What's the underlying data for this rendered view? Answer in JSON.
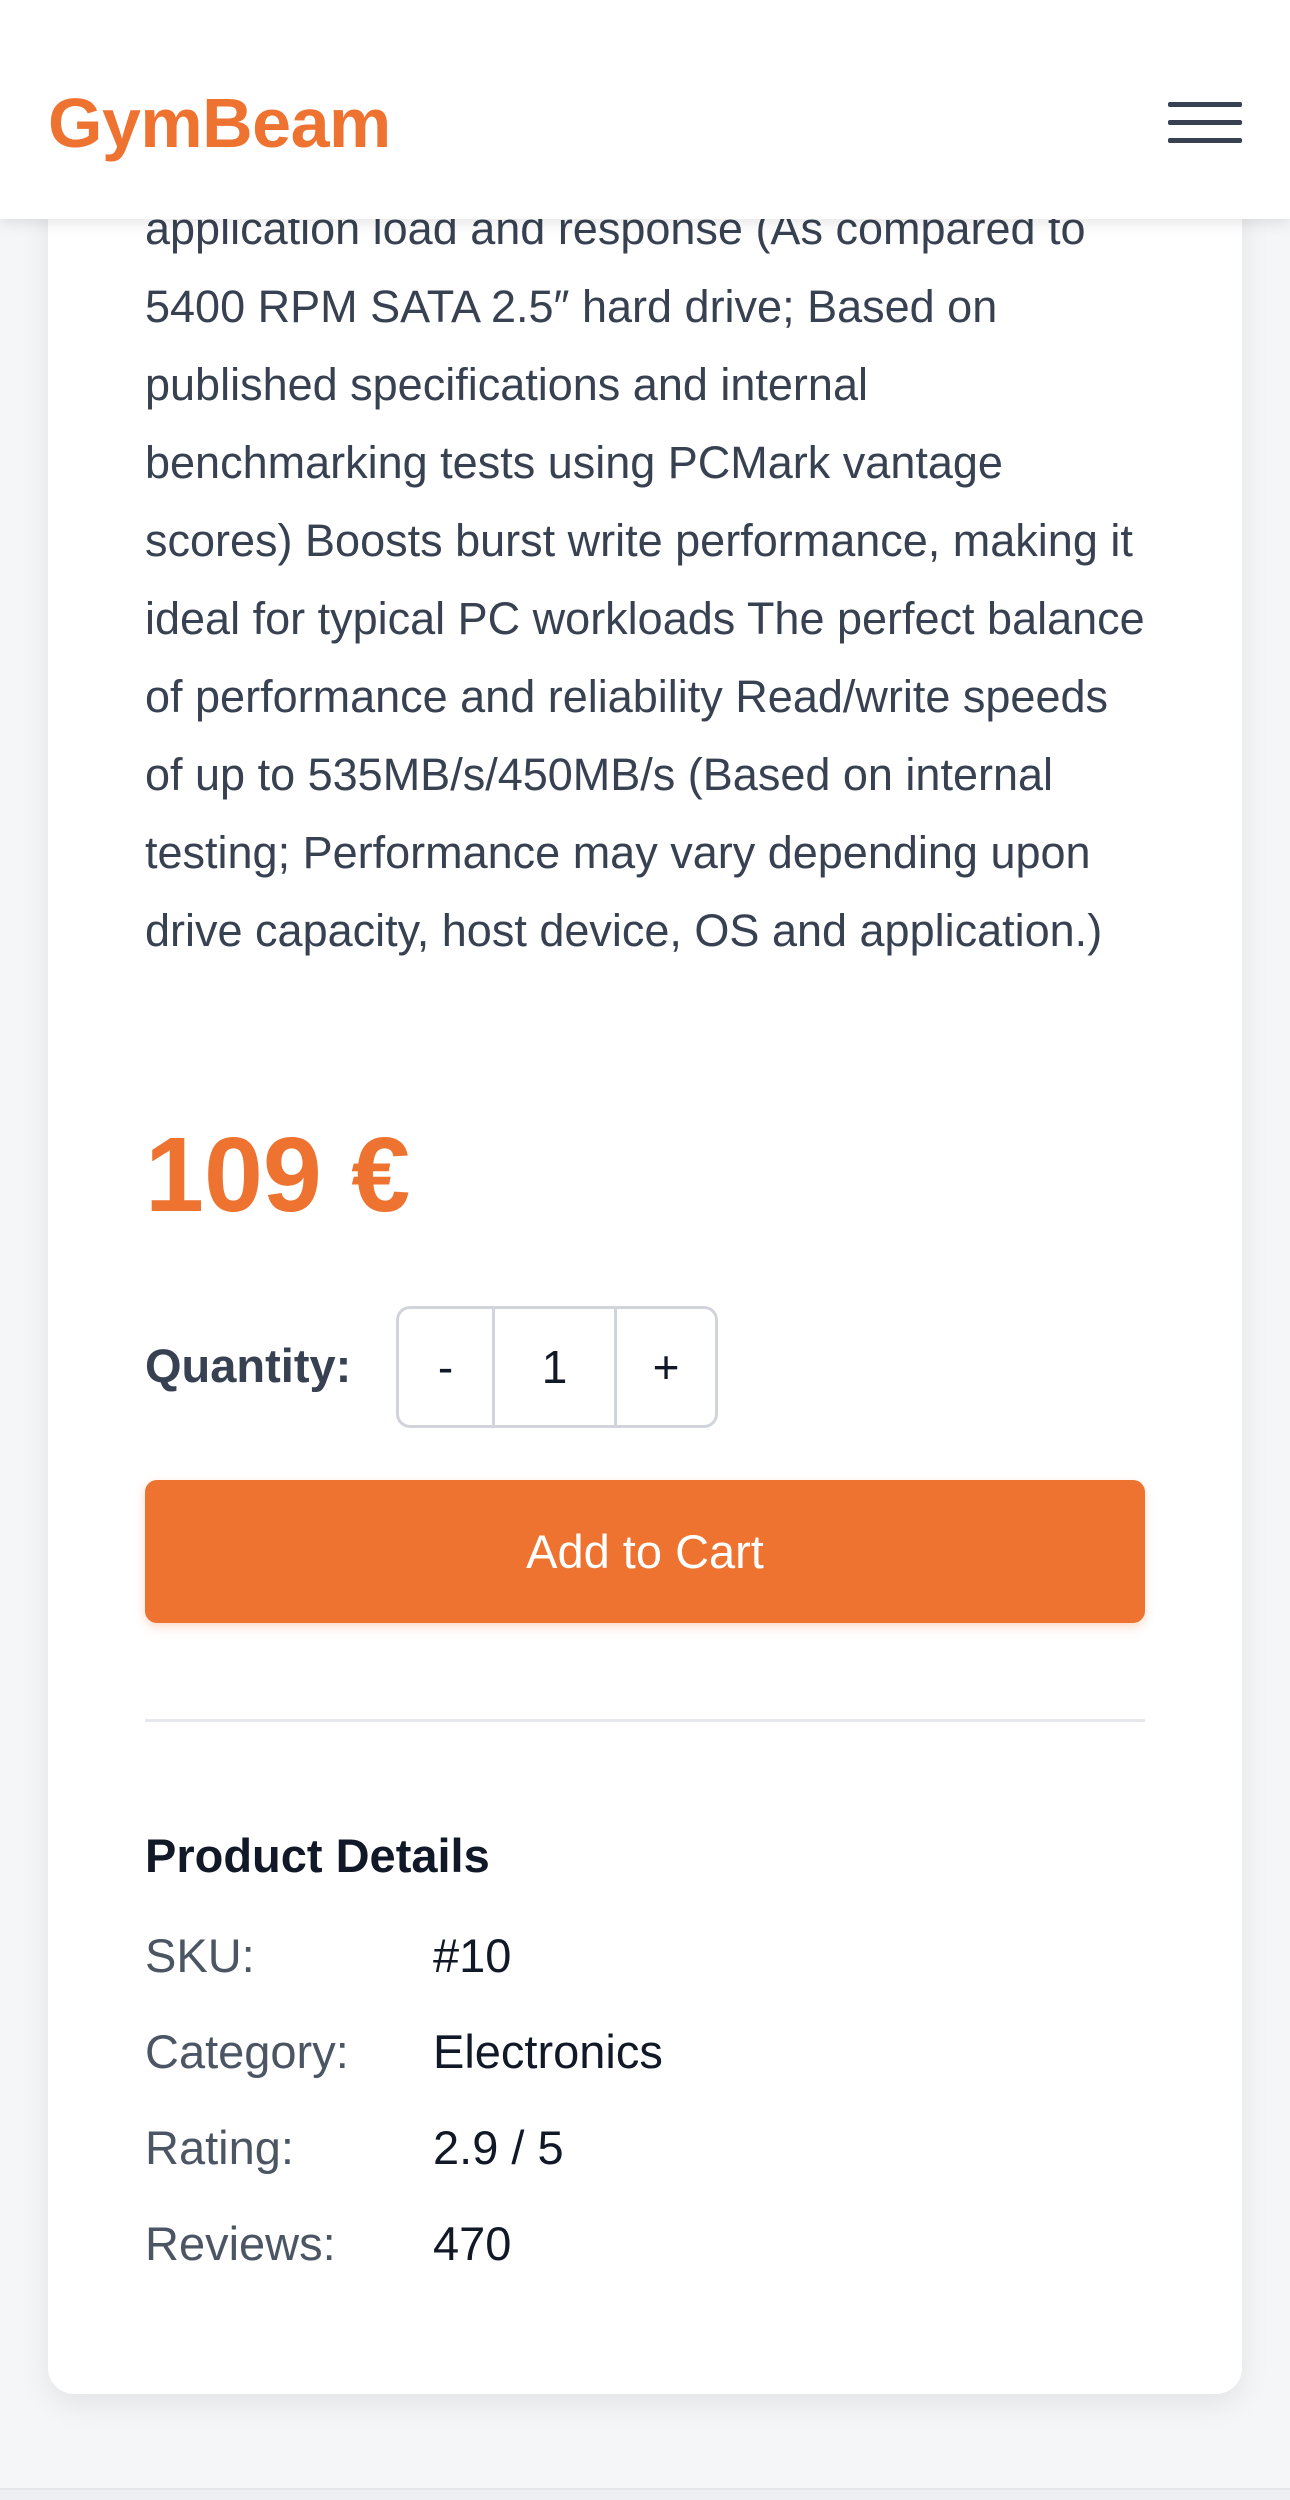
{
  "header": {
    "logo": "GymBeam",
    "menu_icon": "hamburger-menu-icon"
  },
  "product": {
    "description": "application load and response (As compared to 5400 RPM SATA 2.5″ hard drive; Based on published specifications and internal benchmarking tests using PCMark vantage scores) Boosts burst write performance, making it ideal for typical PC workloads The perfect balance of performance and reliability Read/write speeds of up to 535MB/s/450MB/s (Based on internal testing; Performance may vary depending upon drive capacity, host device, OS and application.)",
    "price": "109 €",
    "quantity_label": "Quantity:",
    "quantity_minus": "-",
    "quantity_value": "1",
    "quantity_plus": "+",
    "add_to_cart": "Add to Cart"
  },
  "details": {
    "title": "Product Details",
    "rows": [
      {
        "label": "SKU:",
        "value": "#10"
      },
      {
        "label": "Category:",
        "value": "Electronics"
      },
      {
        "label": "Rating:",
        "value": "2.9 / 5"
      },
      {
        "label": "Reviews:",
        "value": "470"
      }
    ]
  },
  "colors": {
    "accent": "#ee7330",
    "text": "#374151",
    "background": "#f5f6f8"
  }
}
